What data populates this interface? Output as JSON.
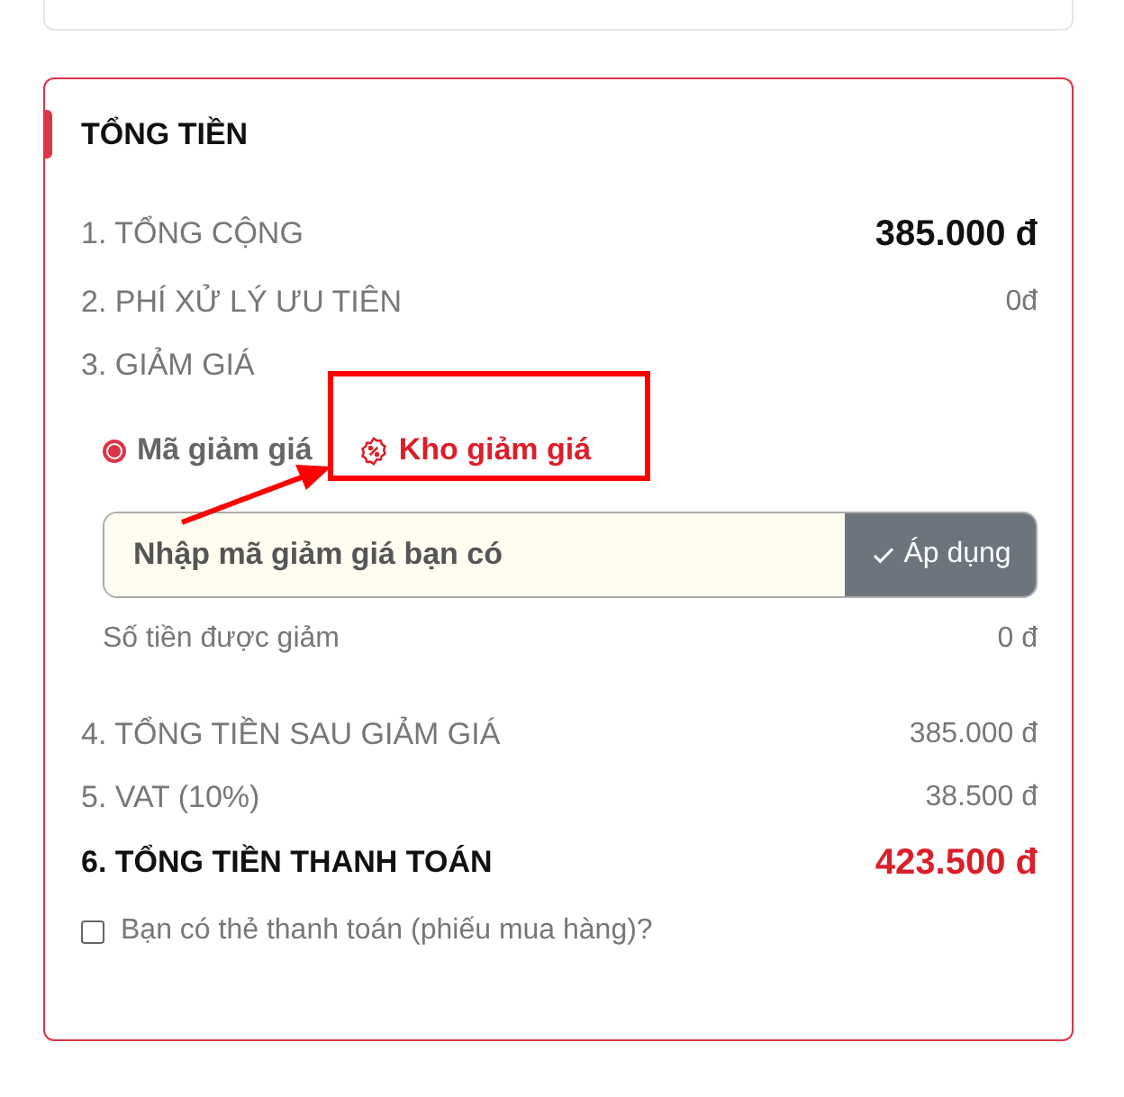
{
  "title": "TỔNG TIỀN",
  "rows_before": [
    {
      "kind": "total",
      "label": "1. TỔNG CỘNG",
      "value": "385.000 đ"
    },
    {
      "kind": "plain",
      "label": "2. PHÍ XỬ LÝ ƯU TIÊN",
      "value": "0đ"
    },
    {
      "kind": "heading",
      "label": "3. GIẢM GIÁ"
    }
  ],
  "discount": {
    "options": [
      {
        "label": "Mã giảm giá",
        "selected": true
      }
    ],
    "store_link": "Kho giảm giá",
    "input": {
      "placeholder": "Nhập mã giảm giá bạn có"
    },
    "apply_button": "Áp dụng",
    "amount_label": "Số tiền được giảm",
    "amount_value": "0 đ"
  },
  "rows_after": [
    {
      "kind": "plain",
      "label": "4. TỔNG TIỀN SAU GIẢM GIÁ",
      "value": "385.000 đ"
    },
    {
      "kind": "plain",
      "label": "5. VAT (10%)",
      "value": "38.500 đ"
    },
    {
      "kind": "grand",
      "label": "6. TỔNG TIỀN THANH TOÁN",
      "value": "423.500 đ"
    }
  ],
  "voucher_checkbox": {
    "label": "Bạn có thẻ thanh toán (phiếu mua hàng)?",
    "checked": false
  }
}
